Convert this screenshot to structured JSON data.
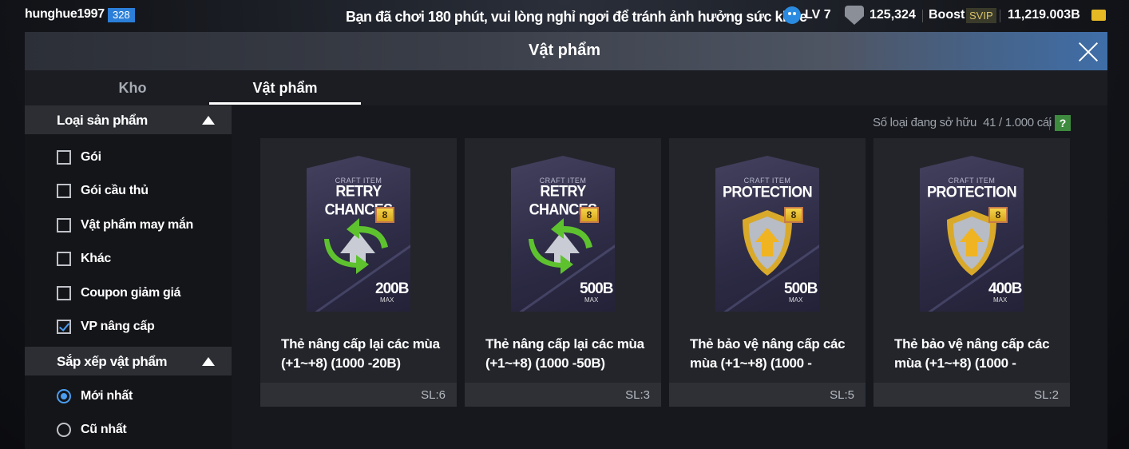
{
  "topbar": {
    "username": "hunghue1997",
    "user_level": "328",
    "notice": "Bạn đã chơi 180 phút, vui lòng nghỉ ngơi để tránh ảnh hưởng sức khỏe",
    "lv": "LV 7",
    "coins": "125,324",
    "boost_label": "Boost",
    "svip_label": "SVIP",
    "balance": "11,219.003B"
  },
  "dialog": {
    "title": "Vật phẩm",
    "tabs": [
      {
        "label": "Kho",
        "selected": false
      },
      {
        "label": "Vật phẩm",
        "selected": true
      }
    ]
  },
  "sidebar": {
    "product_type_title": "Loại sản phẩm",
    "product_types": [
      {
        "label": "Gói",
        "checked": false
      },
      {
        "label": "Gói cầu thủ",
        "checked": false
      },
      {
        "label": "Vật phẩm may mắn",
        "checked": false
      },
      {
        "label": "Khác",
        "checked": false
      },
      {
        "label": "Coupon giảm giá",
        "checked": false
      },
      {
        "label": "VP nâng cấp",
        "checked": true
      }
    ],
    "sort_title": "Sắp xếp vật phẩm",
    "sort_options": [
      {
        "label": "Mới nhất",
        "selected": true
      },
      {
        "label": "Cũ nhất",
        "selected": false
      }
    ]
  },
  "inventory": {
    "owned_label": "Số loại đang sở hữu",
    "owned_value": "41 / 1.000 cái",
    "help_label": "?"
  },
  "items": [
    {
      "craft_label": "CRAFT ITEM",
      "craft_name": "RETRY CHANCES",
      "icon": "retry-arrows-icon",
      "level_badge": "8",
      "price": "200B",
      "max_label": "MAX",
      "name": "Thẻ nâng cấp lại các mùa (+1~+8) (1000 -20B)",
      "qty": "SL:6"
    },
    {
      "craft_label": "CRAFT ITEM",
      "craft_name": "RETRY CHANCES",
      "icon": "retry-arrows-icon",
      "level_badge": "8",
      "price": "500B",
      "max_label": "MAX",
      "name": "Thẻ nâng cấp lại các mùa (+1~+8) (1000 -50B)",
      "qty": "SL:3"
    },
    {
      "craft_label": "CRAFT ITEM",
      "craft_name": "PROTECTION",
      "icon": "shield-icon",
      "level_badge": "8",
      "price": "500B",
      "max_label": "MAX",
      "name": "Thẻ bảo vệ nâng cấp các mùa (+1~+8) (1000 -",
      "qty": "SL:5"
    },
    {
      "craft_label": "CRAFT ITEM",
      "craft_name": "PROTECTION",
      "icon": "shield-icon",
      "level_badge": "8",
      "price": "400B",
      "max_label": "MAX",
      "name": "Thẻ bảo vệ nâng cấp các mùa (+1~+8) (1000 -",
      "qty": "SL:2"
    }
  ],
  "colors": {
    "accent": "#4a9df0",
    "level_badge": "#2b7fd9",
    "svip": "#d8c36a",
    "help": "#3e8a3e"
  }
}
